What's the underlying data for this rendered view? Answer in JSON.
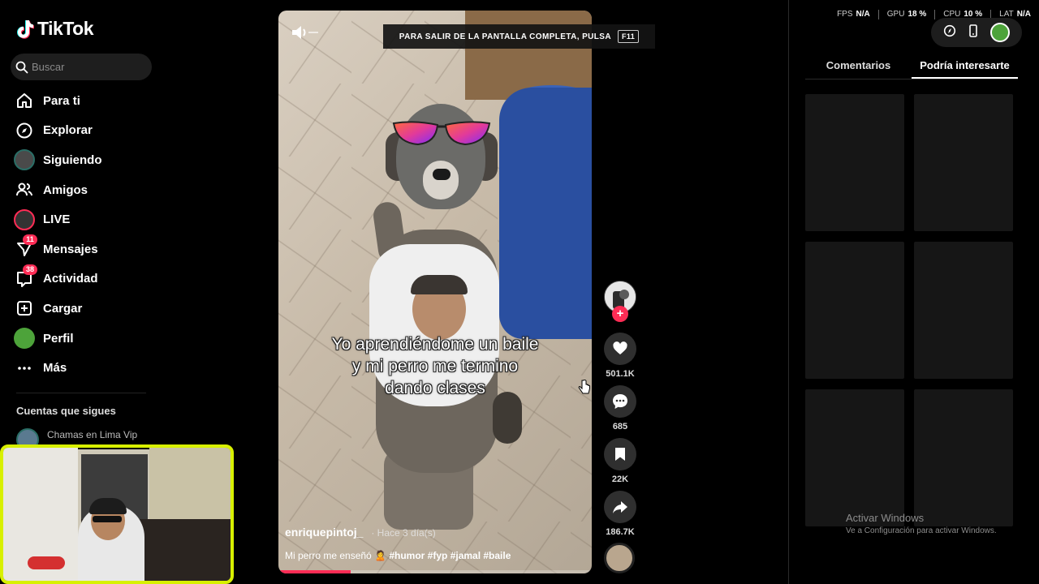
{
  "app": {
    "logo_text": "TikTok"
  },
  "search": {
    "placeholder": "Buscar"
  },
  "sidebar": {
    "items": [
      {
        "label": "Para ti",
        "icon": "home-icon"
      },
      {
        "label": "Explorar",
        "icon": "compass-icon"
      },
      {
        "label": "Siguiendo",
        "icon": "following-avatar"
      },
      {
        "label": "Amigos",
        "icon": "friends-icon"
      },
      {
        "label": "LIVE",
        "icon": "live-avatar"
      },
      {
        "label": "Mensajes",
        "icon": "messages-icon",
        "badge": "11"
      },
      {
        "label": "Actividad",
        "icon": "activity-icon",
        "badge": "38"
      },
      {
        "label": "Cargar",
        "icon": "upload-icon"
      },
      {
        "label": "Perfil",
        "icon": "profile-avatar"
      },
      {
        "label": "Más",
        "icon": "more-icon"
      }
    ],
    "following_title": "Cuentas que sigues",
    "following": [
      {
        "name": "Chamas en Lima Vip"
      }
    ]
  },
  "fullscreen_notice": {
    "text": "PARA SALIR DE LA PANTALLA COMPLETA, PULSA",
    "key": "F11"
  },
  "video": {
    "caption": "Yo aprendiéndome un baile y mi perro me termino dando clases",
    "author": "enriquepintoj_",
    "posted": "· Hace 3 día(s)",
    "description": "Mi perro me enseñó 🙎",
    "hashtags": "#humor #fyp #jamal #baile",
    "progress": 0.23
  },
  "actions": {
    "likes": "501.1K",
    "comments": "685",
    "saves": "22K",
    "shares": "186.7K"
  },
  "perf_stats": [
    {
      "label": "FPS",
      "value": "N/A"
    },
    {
      "label": "GPU",
      "value": "18 %"
    },
    {
      "label": "CPU",
      "value": "10 %"
    },
    {
      "label": "LAT",
      "value": "N/A"
    }
  ],
  "right_panel": {
    "tabs": [
      {
        "label": "Comentarios"
      },
      {
        "label": "Podría interesarte",
        "active": true
      }
    ],
    "thumbnail_count": 6
  },
  "windows_watermark": {
    "line1": "Activar Windows",
    "line2": "Ve a Configuración para activar Windows."
  },
  "colors": {
    "accent": "#fe2c55",
    "webcam_border": "#d8f000"
  }
}
